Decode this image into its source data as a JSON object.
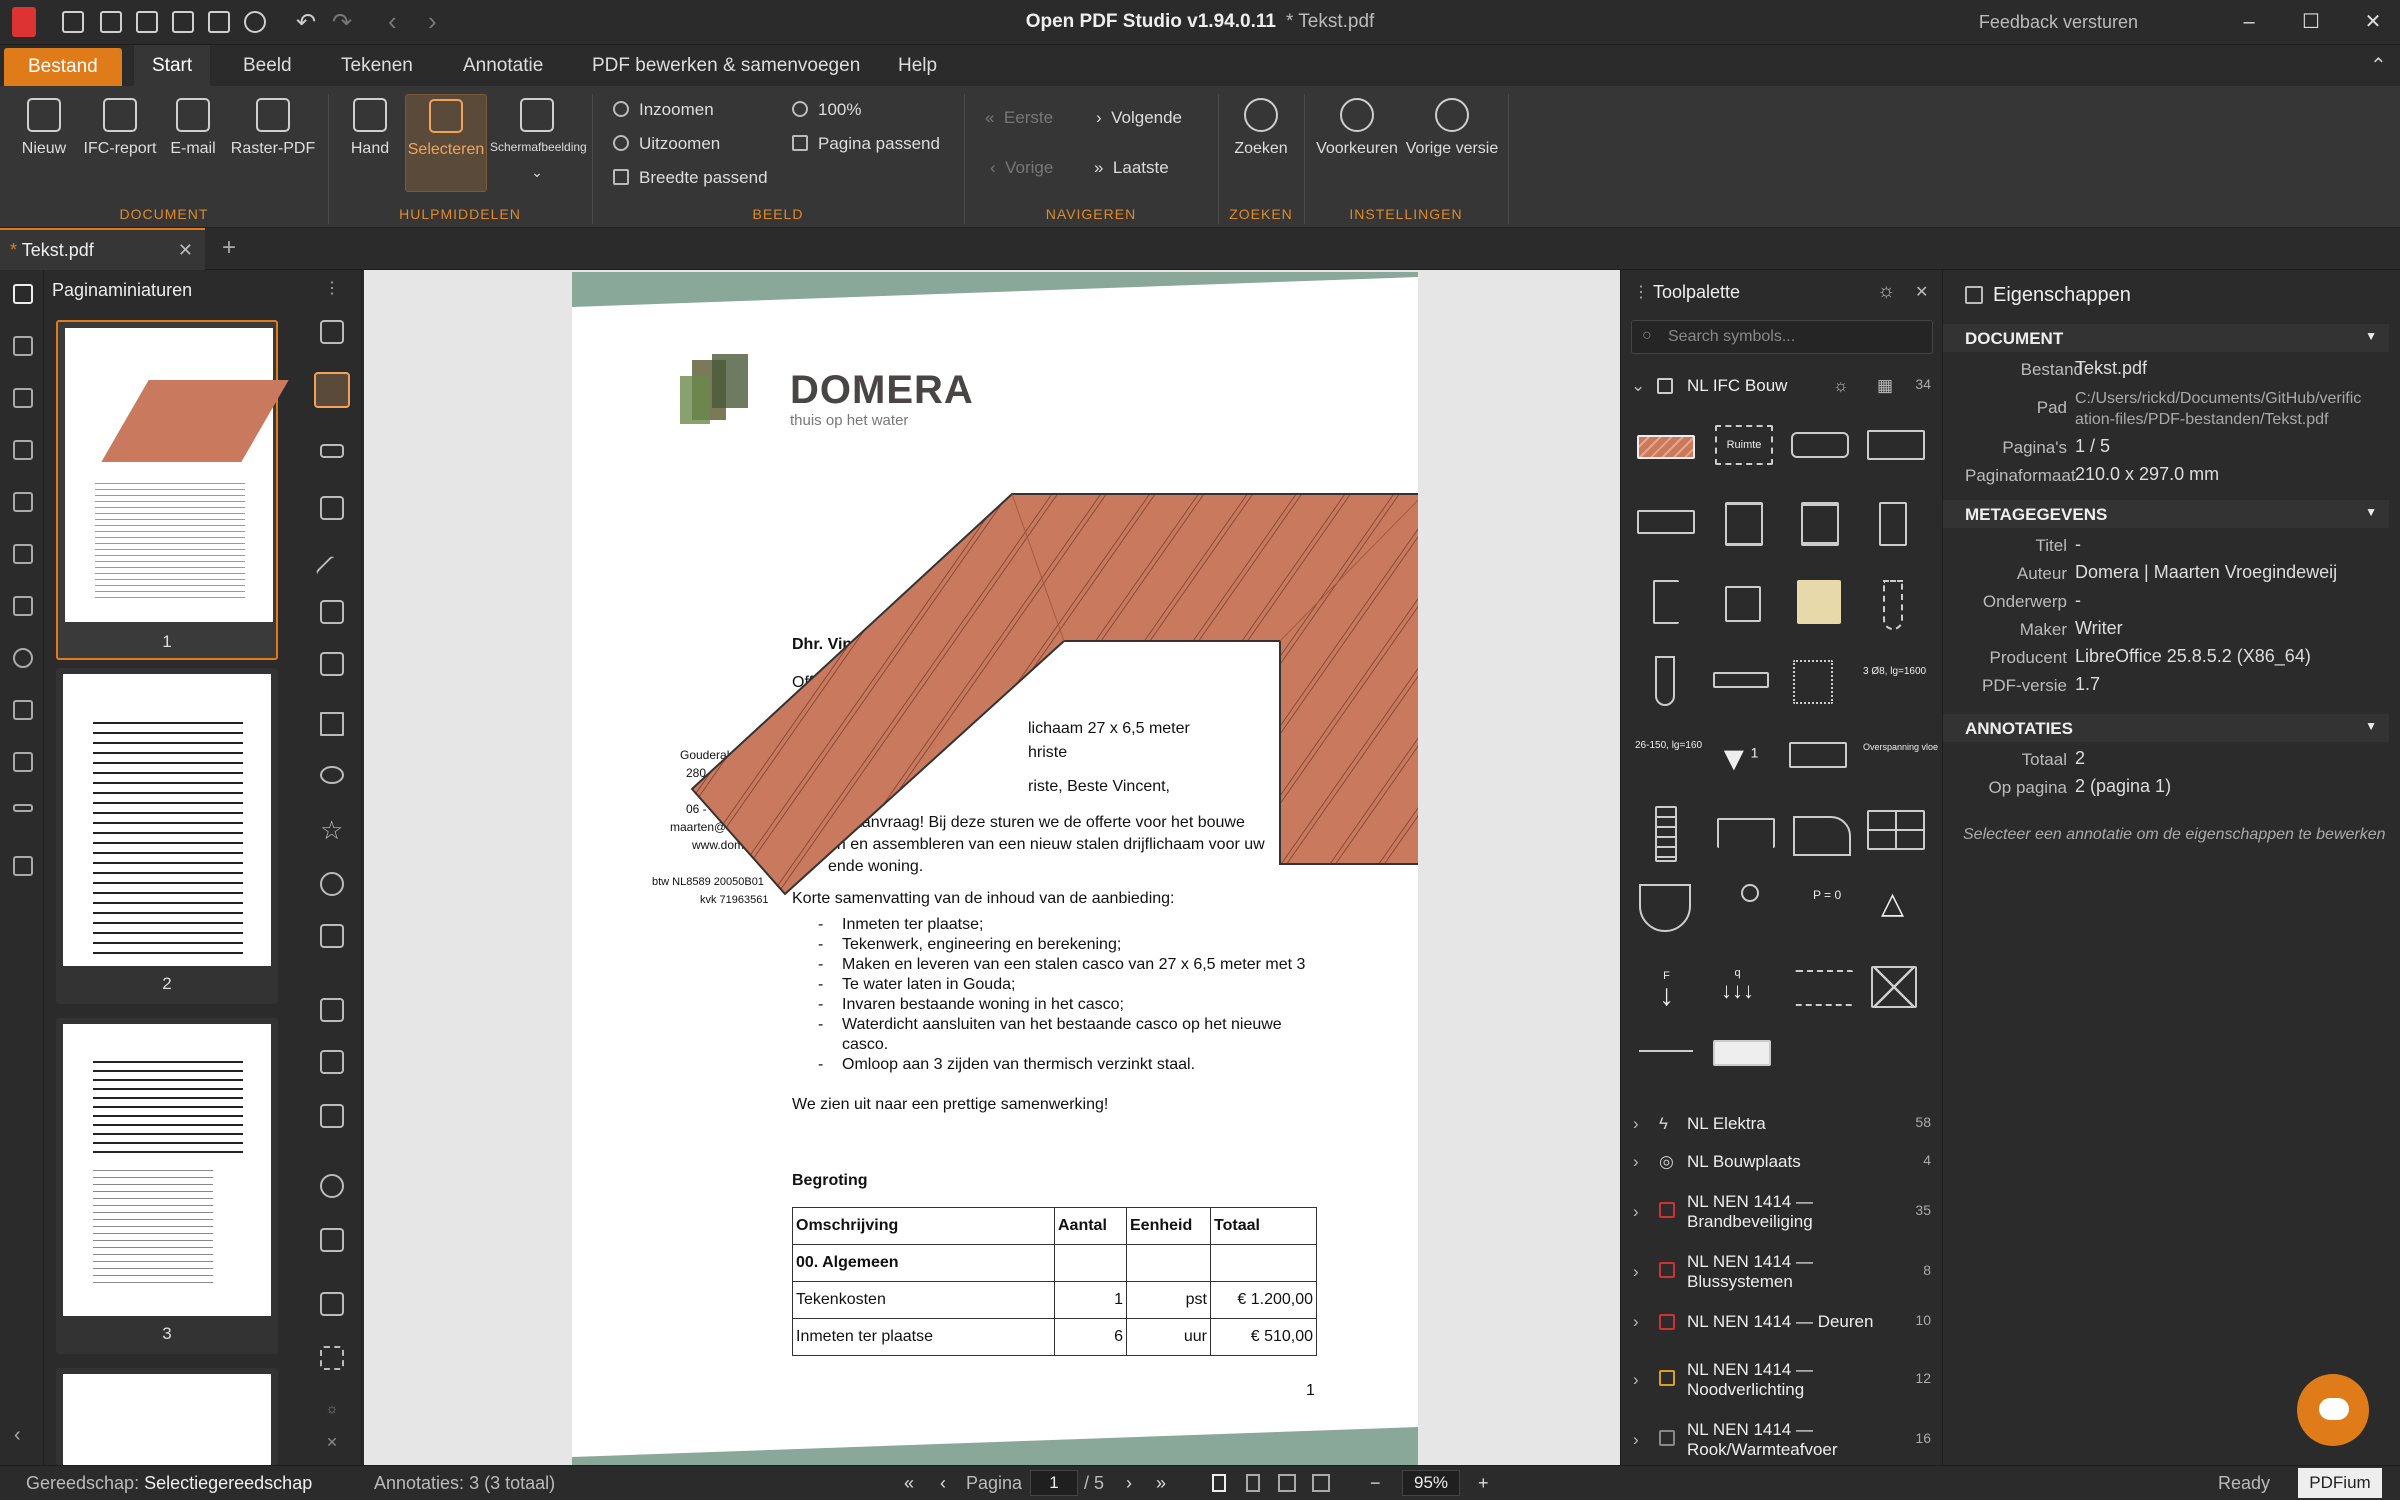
{
  "app": {
    "title": "Open PDF Studio v1.94.0.11",
    "file": "* Tekst.pdf",
    "feedback": "Feedback versturen"
  },
  "menu": [
    "Bestand",
    "Start",
    "Beeld",
    "Tekenen",
    "Annotatie",
    "PDF bewerken & samenvoegen",
    "Help"
  ],
  "ribbon": {
    "document": {
      "label": "DOCUMENT",
      "items": [
        "Nieuw",
        "IFC-report",
        "E-mail",
        "Raster-PDF"
      ]
    },
    "hulp": {
      "label": "HULPMIDDELEN",
      "items": [
        "Hand",
        "Selecteren",
        "Schermafbeelding"
      ]
    },
    "beeld": {
      "label": "BEELD",
      "zoomin": "Inzoomen",
      "zoomout": "Uitzoomen",
      "width": "Breedte passend",
      "pct": "100%",
      "fitpage": "Pagina passend"
    },
    "nav": {
      "label": "NAVIGEREN",
      "first": "Eerste",
      "next": "Volgende",
      "prev": "Vorige",
      "last": "Laatste"
    },
    "zoeken": {
      "label": "ZOEKEN",
      "item": "Zoeken"
    },
    "inst": {
      "label": "INSTELLINGEN",
      "prefs": "Voorkeuren",
      "prev": "Vorige versie"
    }
  },
  "doctab": "Tekst.pdf",
  "thumbs": {
    "title": "Paginaminiaturen",
    "pages": [
      "1",
      "2",
      "3"
    ]
  },
  "pdf": {
    "brand": "DOMERA",
    "tagline": "thuis op het water",
    "salutation": "Dhr. Vin",
    "l1": "Off",
    "l2": "lichaam 27 x 6,5 meter",
    "l3": "hriste",
    "l4": "riste, Beste Vincent,",
    "l5": "uw aanvraag! Bij deze sturen we de offerte voor het bouwe",
    "l6": "en en assembleren van een nieuw stalen drijflichaam voor uw",
    "l7": "ende woning.",
    "side": [
      "Gouderaks",
      "280",
      "06 -",
      "maarten@d",
      "www.dome",
      "btw NL8589 20050B01",
      "kvk 71963561"
    ],
    "summary": "Korte samenvatting van de inhoud van de aanbieding:",
    "bullets": [
      "Inmeten ter plaatse;",
      "Tekenwerk, engineering en berekening;",
      "Maken en leveren van een stalen casco van 27 x 6,5 meter met 3",
      "Te water laten in Gouda;",
      "Invaren bestaande woning in het casco;",
      "Waterdicht aansluiten van het bestaande casco op het nieuwe",
      "casco.",
      "Omloop aan 3 zijden van thermisch verzinkt staal."
    ],
    "closing": "We zien uit naar een prettige samenwerking!",
    "begroting": "Begroting",
    "table": {
      "head": [
        "Omschrijving",
        "Aantal",
        "Eenheid",
        "Totaal"
      ],
      "group": "00. Algemeen",
      "rows": [
        [
          "Tekenkosten",
          "1",
          "pst",
          "€ 1.200,00"
        ],
        [
          "Inmeten ter plaatse",
          "6",
          "uur",
          "€ 510,00"
        ]
      ]
    },
    "pagenum": "1"
  },
  "toolpalette": {
    "title": "Toolpalette",
    "search": "Search symbols...",
    "open": {
      "name": "NL IFC Bouw",
      "count": "34"
    },
    "symlabels": {
      "ruimte": "Ruimte",
      "s1": "3 Ø8, lg=1600",
      "s2": "26-150, lg=160",
      "s3": "Overspanning vloe",
      "s4": "1",
      "s5": "P = 0",
      "s6": "F",
      "s7": "q"
    },
    "cats": [
      {
        "name": "NL Elektra",
        "count": "58"
      },
      {
        "name": "NL Bouwplaats",
        "count": "4"
      },
      {
        "name": "NL NEN 1414 —",
        "name2": "Brandbeveiliging",
        "count": "35"
      },
      {
        "name": "NL NEN 1414 —",
        "name2": "Blussystemen",
        "count": "8"
      },
      {
        "name": "NL NEN 1414 — Deuren",
        "count": "10"
      },
      {
        "name": "NL NEN 1414 —",
        "name2": "Noodverlichting",
        "count": "12"
      },
      {
        "name": "NL NEN 1414 —",
        "name2": "Rook/Warmteafvoer",
        "count": "16"
      }
    ]
  },
  "props": {
    "title": "Eigenschappen",
    "doc": {
      "label": "DOCUMENT",
      "bestand_l": "Bestand",
      "bestand": "Tekst.pdf",
      "pad_l": "Pad",
      "pad1": "C:/Users/rickd/Documents/GitHub/verific",
      "pad2": "ation-files/PDF-bestanden/Tekst.pdf",
      "pages_l": "Pagina's",
      "pages": "1 / 5",
      "format_l": "Paginaformaat",
      "format": "210.0 x 297.0 mm"
    },
    "meta": {
      "label": "METAGEGEVENS",
      "titel_l": "Titel",
      "titel": "-",
      "auteur_l": "Auteur",
      "auteur": "Domera | Maarten Vroegindeweij",
      "onderwerp_l": "Onderwerp",
      "onderwerp": "-",
      "maker_l": "Maker",
      "maker": "Writer",
      "prod_l": "Producent",
      "prod": "LibreOffice 25.8.5.2 (X86_64)",
      "ver_l": "PDF-versie",
      "ver": "1.7"
    },
    "annot": {
      "label": "ANNOTATIES",
      "tot_l": "Totaal",
      "tot": "2",
      "op_l": "Op pagina",
      "op": "2 (pagina 1)",
      "hint": "Selecteer een annotatie om de eigenschappen te bewerken"
    }
  },
  "status": {
    "tool_l": "Gereedschap:",
    "tool": "Selectiegereedschap",
    "annot": "Annotaties: 3 (3 totaal)",
    "pagina": "Pagina",
    "page": "1",
    "of": "/ 5",
    "zoom": "95%",
    "ready": "Ready",
    "engine": "PDFium"
  }
}
